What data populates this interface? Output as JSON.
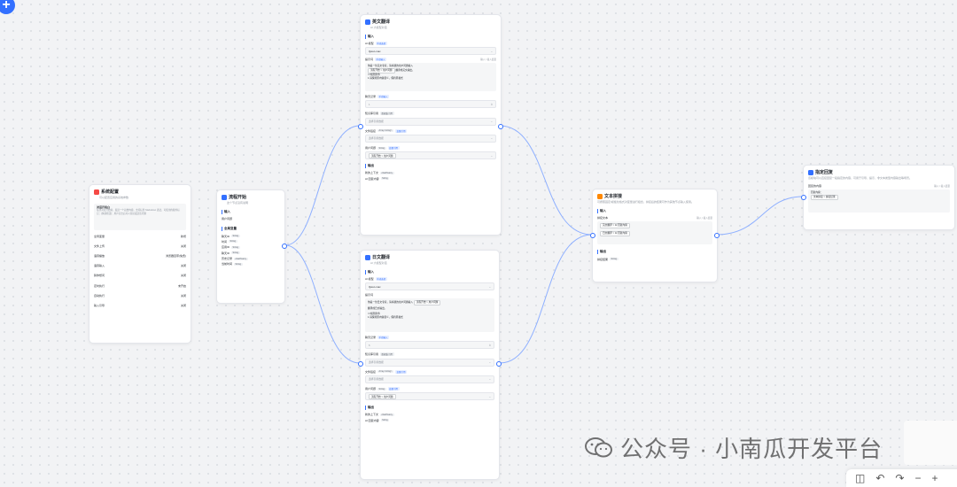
{
  "canvas": {
    "add_icon": "plus-icon"
  },
  "system_node": {
    "title": "系统配置",
    "desc": "可以配置应用的系统参数",
    "welcome_label": "对话开场白",
    "welcome_text": "每次对话开始前，发送一个初始内容。支持标准 Markdown 语法，可使用的额外标记：[快捷按钮]：用户点击后可以直接发送该问题",
    "rows": [
      {
        "label": "全局变量",
        "value": "新增"
      },
      {
        "label": "文件上传",
        "value": "关闭"
      },
      {
        "label": "语音播放",
        "value": "浏览器自带(免费)"
      },
      {
        "label": "语音输入",
        "value": "关闭"
      },
      {
        "label": "猜你想问",
        "value": "关闭"
      },
      {
        "label": "定时执行",
        "value": "未开启"
      },
      {
        "label": "自动执行",
        "value": "关闭"
      },
      {
        "label": "输入引导",
        "value": "关闭"
      }
    ]
  },
  "flow_start": {
    "title": "流程开始",
    "desc": "这个节点没有说明",
    "input_title": "输入",
    "user_question": "用户问题",
    "globals_title": "全局变量",
    "globals": [
      {
        "name": "聊天ID",
        "type": "String"
      },
      {
        "name": "时间",
        "type": "String"
      },
      {
        "name": "应用ID",
        "type": "String"
      },
      {
        "name": "聊天ID",
        "type": "String"
      },
      {
        "name": "历史记录",
        "type": "chatHistory"
      },
      {
        "name": "当前时间",
        "type": "String"
      }
    ]
  },
  "english_node": {
    "title": "英文翻译",
    "desc": "AI 大模型对话",
    "input_title": "输入",
    "model_label": "AI 模型",
    "model_mode": "手动选择",
    "model": "Qwen-max",
    "prompt_label": "提示词",
    "prompt_mode": "手动输入",
    "prompt_hint": "输入 / 插入变量",
    "prompt_lines": [
      "你是一位英文专家，请将我的用户问题输入",
      "流程开始 > 用户问题",
      "翻译成英文输出。",
      "==规则条件",
      "1.请保持原内容语义，保持原格式"
    ],
    "history_label": "聊天记录",
    "history_mode": "手动输入",
    "history_value": "1",
    "kb_label": "知识库引用",
    "kb_type": "数据集引用",
    "kb_placeholder": "选择引用数据",
    "file_label": "文件链接",
    "file_type": "Array<string>",
    "file_mode": "变量引用",
    "file_placeholder": "选择引用数据",
    "question_label": "用户问题",
    "question_type": "String",
    "question_mode": "变量引用",
    "question_value": "流程开始 > 用户问题",
    "output_title": "输出",
    "outputs": [
      {
        "name": "新的上下文",
        "type": "chatHistory"
      },
      {
        "name": "AI 回复内容",
        "type": "String"
      }
    ]
  },
  "japanese_node": {
    "title": "日文翻译",
    "desc": "AI 大模型对话",
    "input_title": "输入",
    "model_label": "AI 模型",
    "model_mode": "手动选择",
    "model": "Qwen-max",
    "prompt_label": "提示词",
    "prompt_lines": [
      "你是一位日文专家，请将我的用户问题输入",
      "流程开始 > 用户问题",
      "翻译成日文输出。",
      "==规则条件",
      "1.请保持原内容语义，保持原格式"
    ],
    "history_label": "聊天记录",
    "history_mode": "手动输入",
    "history_value": "6",
    "kb_label": "知识库引用",
    "kb_type": "数据集引用",
    "kb_placeholder": "选择引用数据",
    "file_label": "文件链接",
    "file_type": "Array<string>",
    "file_mode": "变量引用",
    "file_placeholder": "选择引用数据",
    "question_label": "用户问题",
    "question_type": "String",
    "question_mode": "变量引用",
    "question_value": "流程开始 > 用户问题",
    "output_title": "输出",
    "outputs": [
      {
        "name": "新的上下文",
        "type": "chatHistory"
      },
      {
        "name": "AI 回复内容",
        "type": "String"
      }
    ]
  },
  "text_node": {
    "title": "文本拼接",
    "desc": "可按照固定/模板化格式对变量进行组合，拼接后的结果可作为其他节点输入使用。",
    "input_title": "输入",
    "concat_label": "拼接文本",
    "concat_hint": "输入 / 插入变量",
    "lines": [
      "英文翻译 > AI 回复内容",
      "日文翻译 > AI 回复内容"
    ],
    "output_title": "输出",
    "output_name": "拼接结果",
    "output_type": "String"
  },
  "reply_node": {
    "title": "指定回复",
    "desc": "该模块可以直接回复一段指定的内容，可用于引导、提示、非文本类型内容输出等场景。",
    "label": "回复的内容",
    "hint": "输入 / 插入变量",
    "text": "回复内容：",
    "chip": "文本拼接 > 拼接结果"
  },
  "watermark": {
    "text": "公众号 · 小南瓜开发平台",
    "icon": "wechat-icon"
  },
  "toolbar": {
    "icons": [
      "mouse-icon",
      "undo-icon",
      "redo-icon",
      "zoom-out-icon",
      "zoom-in-icon"
    ]
  },
  "colors": {
    "accent": "#3370ff",
    "edge": "#8fb0ff",
    "orange": "#ff8800"
  }
}
